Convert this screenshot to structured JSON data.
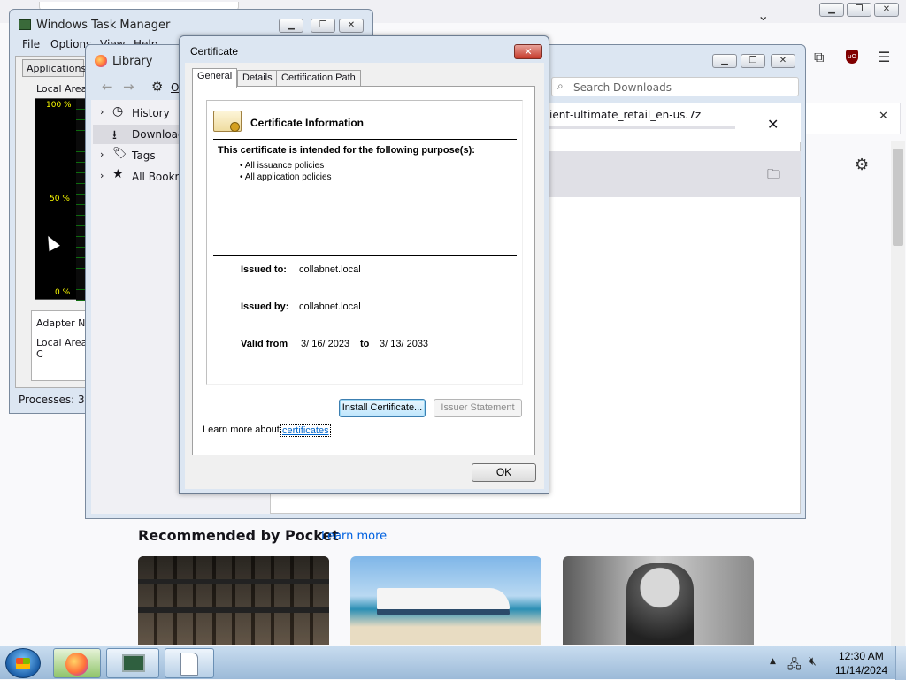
{
  "firefox": {
    "pocket_title": "Recommended by Pocket",
    "pocket_link": "Learn more",
    "banner_text": "ient-ultimate_retail_en-us.7z",
    "chevron": "⌄"
  },
  "taskmgr": {
    "title": "Windows Task Manager",
    "menu": [
      "File",
      "Options",
      "View",
      "Help"
    ],
    "tab_applications": "Applications",
    "graph_label": "Local Area C",
    "y_top": "100 %",
    "y_mid": "50 %",
    "y_bot": "0 %",
    "adapter_header": "Adapter Na",
    "adapter_row": "Local Area C",
    "status": "Processes: 36"
  },
  "library": {
    "title": "Library",
    "organize": "O",
    "nav": [
      {
        "label": "History"
      },
      {
        "label": "Downloads"
      },
      {
        "label": "Tags"
      },
      {
        "label": "All Bookm"
      }
    ],
    "search_placeholder": "Search Downloads",
    "download_file": "ient-ultimate_retail_en-us.7z"
  },
  "certificate": {
    "title": "Certificate",
    "tabs": [
      "General",
      "Details",
      "Certification Path"
    ],
    "info_heading": "Certificate Information",
    "purpose_heading": "This certificate is intended for the following purpose(s):",
    "purposes": [
      "• All issuance policies",
      "• All application policies"
    ],
    "issued_to_label": "Issued to:",
    "issued_to_value": "collabnet.local",
    "issued_by_label": "Issued by:",
    "issued_by_value": "collabnet.local",
    "valid_from_label": "Valid from",
    "valid_from_value": "3/ 16/ 2023",
    "to_label": "to",
    "valid_to_value": "3/ 13/ 2033",
    "install_button": "Install Certificate...",
    "issuer_button": "Issuer Statement",
    "learn_more_text": "Learn more about",
    "learn_more_link": "certificates",
    "ok_button": "OK"
  },
  "taskbar": {
    "time": "12:30 AM",
    "date": "11/14/2024"
  }
}
